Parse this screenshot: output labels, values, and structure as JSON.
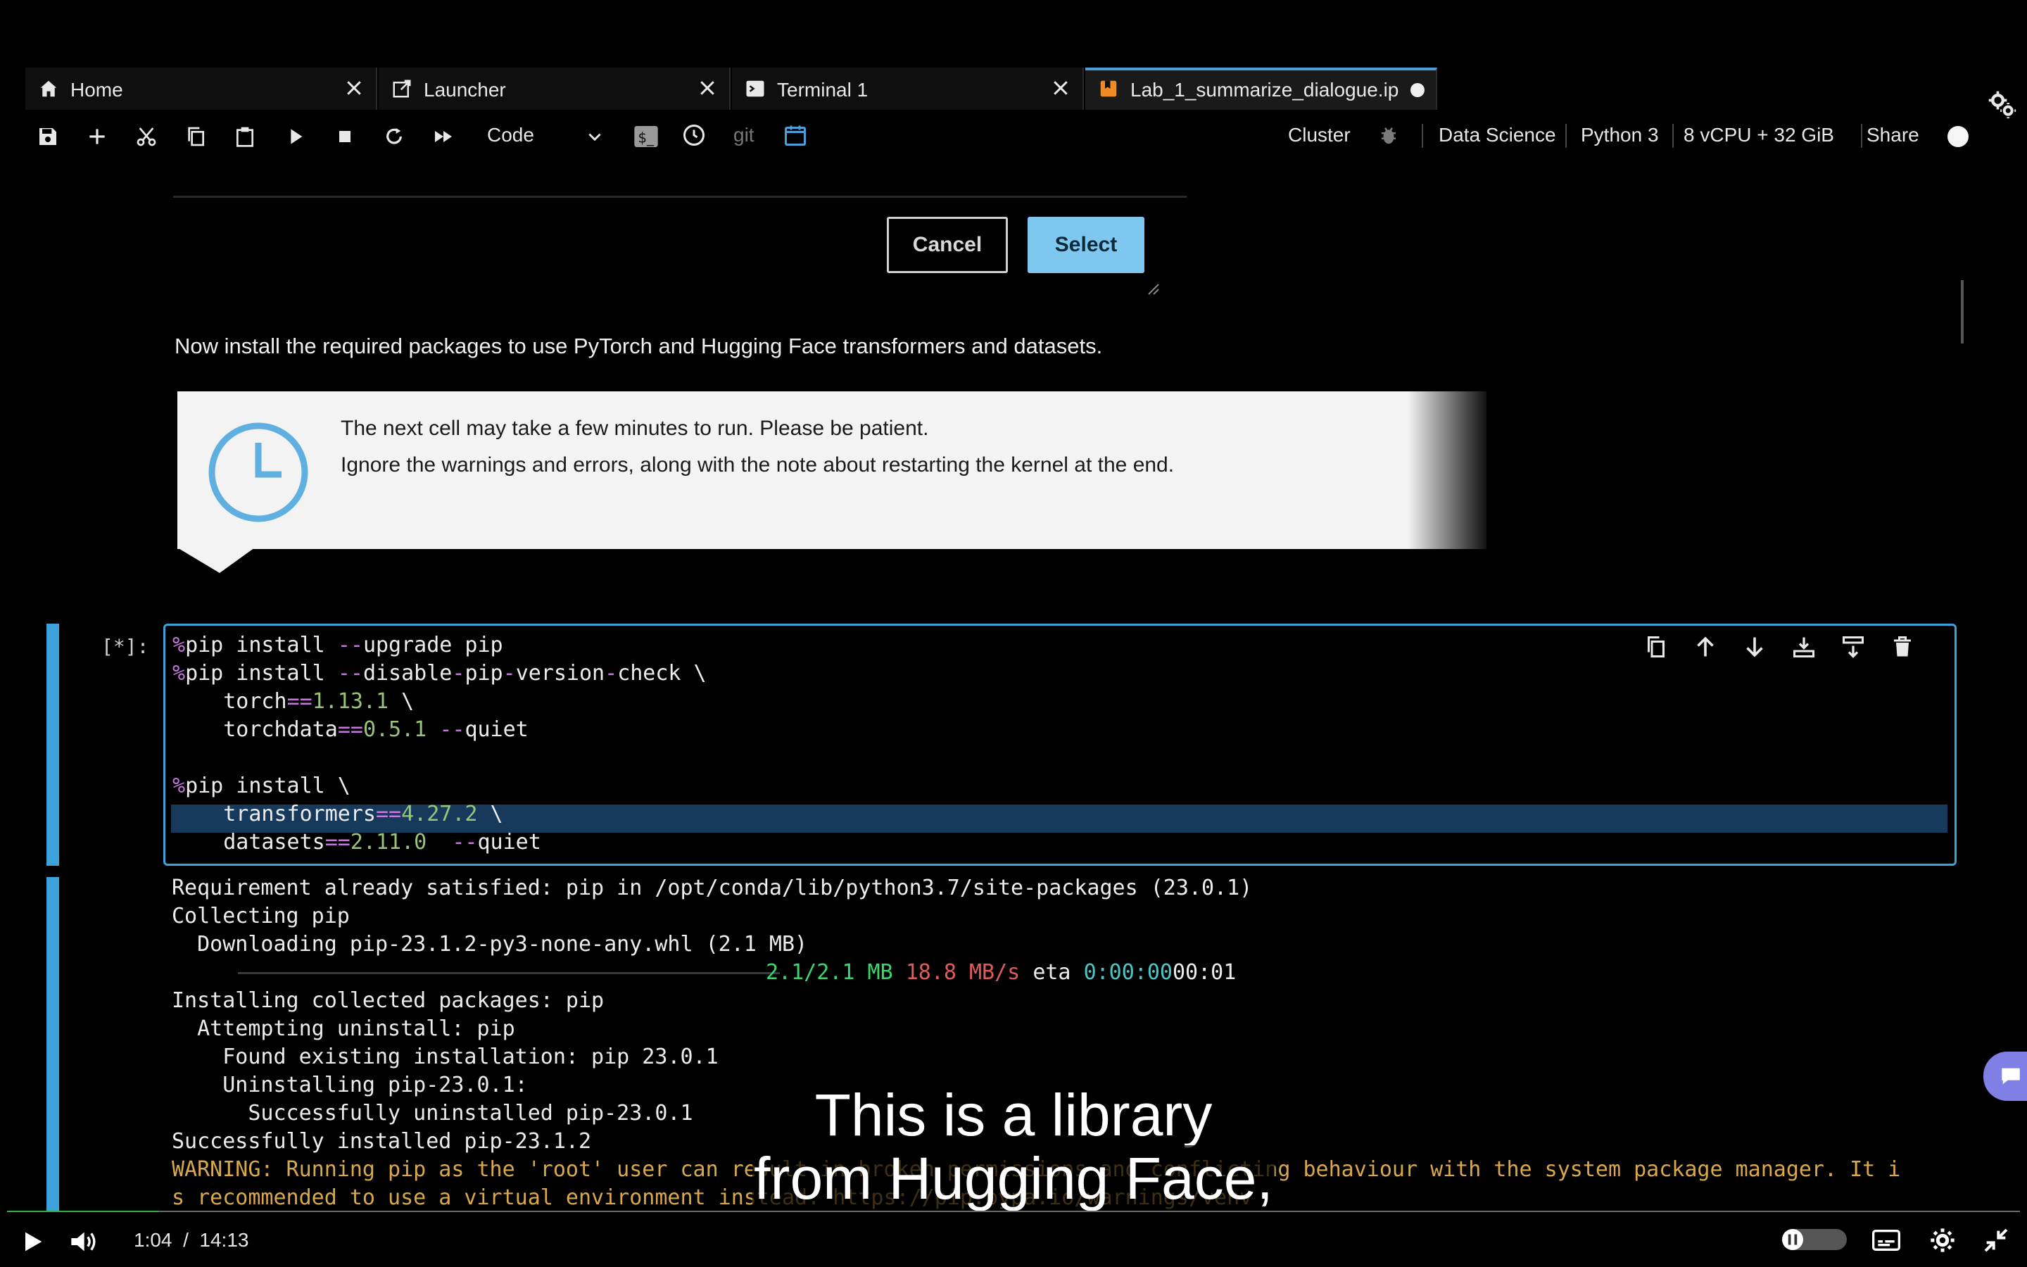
{
  "tabs": [
    {
      "label": "Home",
      "icon": "home-icon"
    },
    {
      "label": "Launcher",
      "icon": "launcher-icon"
    },
    {
      "label": "Terminal 1",
      "icon": "terminal-icon"
    },
    {
      "label": "Lab_1_summarize_dialogue.ip",
      "icon": "notebook-icon",
      "active": true
    }
  ],
  "toolbar": {
    "cell_type": "Code",
    "git_label": "git",
    "cluster_label": "Cluster",
    "image_label": "Data Science",
    "kernel_label": "Python 3",
    "instance_label": "8 vCPU + 32 GiB",
    "share_label": "Share"
  },
  "dialog": {
    "cancel_label": "Cancel",
    "select_label": "Select"
  },
  "markdown": {
    "install_text": "Now install the required packages to use PyTorch and Hugging Face transformers and datasets."
  },
  "callout": {
    "line1": "The next cell may take a few minutes to run. Please be patient.",
    "line2": "Ignore the warnings and errors, along with the note about restarting the kernel at the end."
  },
  "cell": {
    "prompt": "[*]:",
    "lines": [
      "%pip install --upgrade pip",
      "%pip install --disable-pip-version-check \\",
      "    torch==1.13.1 \\",
      "    torchdata==0.5.1 --quiet",
      "",
      "%pip install \\",
      "    transformers==4.27.2 \\",
      "    datasets==2.11.0  --quiet"
    ]
  },
  "output": {
    "lines": [
      "Requirement already satisfied: pip in /opt/conda/lib/python3.7/site-packages (23.0.1)",
      "Collecting pip",
      "  Downloading pip-23.1.2-py3-none-any.whl (2.1 MB)",
      "",
      "Installing collected packages: pip",
      "  Attempting uninstall: pip",
      "    Found existing installation: pip 23.0.1",
      "    Uninstalling pip-23.0.1:",
      "      Successfully uninstalled pip-23.0.1",
      "Successfully installed pip-23.1.2"
    ],
    "progress_size": "2.1/2.1 MB",
    "progress_speed": "18.8 MB/s",
    "progress_eta_label": "eta",
    "progress_eta": "0:00:00",
    "progress_tail": "00:01",
    "warning_line1": "WARNING: Running pip as the 'root' user can result in broken permissions and conflicting behaviour with the system package manager. It i",
    "warning_line2": "s recommended to use a virtual environment instead: https://pip.pypa.io/warnings/venv"
  },
  "subtitles": {
    "line1": "This is a library",
    "line2": "from Hugging Face,"
  },
  "player": {
    "current_time": "1:04",
    "separator": "/",
    "duration": "14:13",
    "progress": 0.075
  },
  "colors": {
    "accent": "#3da2d9",
    "select_button": "#7ec8ef",
    "progress": "#2fb34a"
  }
}
